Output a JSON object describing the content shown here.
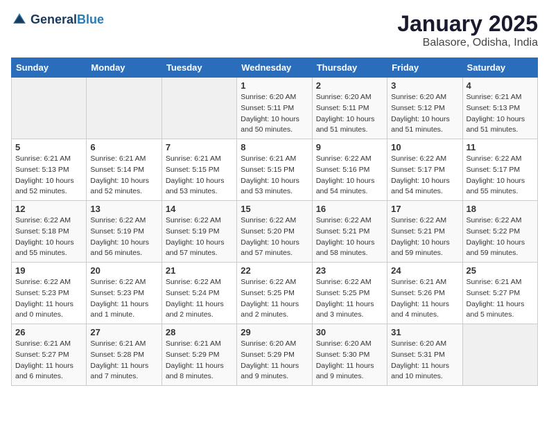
{
  "header": {
    "logo_general": "General",
    "logo_blue": "Blue",
    "month_year": "January 2025",
    "location": "Balasore, Odisha, India"
  },
  "days_of_week": [
    "Sunday",
    "Monday",
    "Tuesday",
    "Wednesday",
    "Thursday",
    "Friday",
    "Saturday"
  ],
  "weeks": [
    [
      {
        "day": "",
        "info": ""
      },
      {
        "day": "",
        "info": ""
      },
      {
        "day": "",
        "info": ""
      },
      {
        "day": "1",
        "info": "Sunrise: 6:20 AM\nSunset: 5:11 PM\nDaylight: 10 hours\nand 50 minutes."
      },
      {
        "day": "2",
        "info": "Sunrise: 6:20 AM\nSunset: 5:11 PM\nDaylight: 10 hours\nand 51 minutes."
      },
      {
        "day": "3",
        "info": "Sunrise: 6:20 AM\nSunset: 5:12 PM\nDaylight: 10 hours\nand 51 minutes."
      },
      {
        "day": "4",
        "info": "Sunrise: 6:21 AM\nSunset: 5:13 PM\nDaylight: 10 hours\nand 51 minutes."
      }
    ],
    [
      {
        "day": "5",
        "info": "Sunrise: 6:21 AM\nSunset: 5:13 PM\nDaylight: 10 hours\nand 52 minutes."
      },
      {
        "day": "6",
        "info": "Sunrise: 6:21 AM\nSunset: 5:14 PM\nDaylight: 10 hours\nand 52 minutes."
      },
      {
        "day": "7",
        "info": "Sunrise: 6:21 AM\nSunset: 5:15 PM\nDaylight: 10 hours\nand 53 minutes."
      },
      {
        "day": "8",
        "info": "Sunrise: 6:21 AM\nSunset: 5:15 PM\nDaylight: 10 hours\nand 53 minutes."
      },
      {
        "day": "9",
        "info": "Sunrise: 6:22 AM\nSunset: 5:16 PM\nDaylight: 10 hours\nand 54 minutes."
      },
      {
        "day": "10",
        "info": "Sunrise: 6:22 AM\nSunset: 5:17 PM\nDaylight: 10 hours\nand 54 minutes."
      },
      {
        "day": "11",
        "info": "Sunrise: 6:22 AM\nSunset: 5:17 PM\nDaylight: 10 hours\nand 55 minutes."
      }
    ],
    [
      {
        "day": "12",
        "info": "Sunrise: 6:22 AM\nSunset: 5:18 PM\nDaylight: 10 hours\nand 55 minutes."
      },
      {
        "day": "13",
        "info": "Sunrise: 6:22 AM\nSunset: 5:19 PM\nDaylight: 10 hours\nand 56 minutes."
      },
      {
        "day": "14",
        "info": "Sunrise: 6:22 AM\nSunset: 5:19 PM\nDaylight: 10 hours\nand 57 minutes."
      },
      {
        "day": "15",
        "info": "Sunrise: 6:22 AM\nSunset: 5:20 PM\nDaylight: 10 hours\nand 57 minutes."
      },
      {
        "day": "16",
        "info": "Sunrise: 6:22 AM\nSunset: 5:21 PM\nDaylight: 10 hours\nand 58 minutes."
      },
      {
        "day": "17",
        "info": "Sunrise: 6:22 AM\nSunset: 5:21 PM\nDaylight: 10 hours\nand 59 minutes."
      },
      {
        "day": "18",
        "info": "Sunrise: 6:22 AM\nSunset: 5:22 PM\nDaylight: 10 hours\nand 59 minutes."
      }
    ],
    [
      {
        "day": "19",
        "info": "Sunrise: 6:22 AM\nSunset: 5:23 PM\nDaylight: 11 hours\nand 0 minutes."
      },
      {
        "day": "20",
        "info": "Sunrise: 6:22 AM\nSunset: 5:23 PM\nDaylight: 11 hours\nand 1 minute."
      },
      {
        "day": "21",
        "info": "Sunrise: 6:22 AM\nSunset: 5:24 PM\nDaylight: 11 hours\nand 2 minutes."
      },
      {
        "day": "22",
        "info": "Sunrise: 6:22 AM\nSunset: 5:25 PM\nDaylight: 11 hours\nand 2 minutes."
      },
      {
        "day": "23",
        "info": "Sunrise: 6:22 AM\nSunset: 5:25 PM\nDaylight: 11 hours\nand 3 minutes."
      },
      {
        "day": "24",
        "info": "Sunrise: 6:21 AM\nSunset: 5:26 PM\nDaylight: 11 hours\nand 4 minutes."
      },
      {
        "day": "25",
        "info": "Sunrise: 6:21 AM\nSunset: 5:27 PM\nDaylight: 11 hours\nand 5 minutes."
      }
    ],
    [
      {
        "day": "26",
        "info": "Sunrise: 6:21 AM\nSunset: 5:27 PM\nDaylight: 11 hours\nand 6 minutes."
      },
      {
        "day": "27",
        "info": "Sunrise: 6:21 AM\nSunset: 5:28 PM\nDaylight: 11 hours\nand 7 minutes."
      },
      {
        "day": "28",
        "info": "Sunrise: 6:21 AM\nSunset: 5:29 PM\nDaylight: 11 hours\nand 8 minutes."
      },
      {
        "day": "29",
        "info": "Sunrise: 6:20 AM\nSunset: 5:29 PM\nDaylight: 11 hours\nand 9 minutes."
      },
      {
        "day": "30",
        "info": "Sunrise: 6:20 AM\nSunset: 5:30 PM\nDaylight: 11 hours\nand 9 minutes."
      },
      {
        "day": "31",
        "info": "Sunrise: 6:20 AM\nSunset: 5:31 PM\nDaylight: 11 hours\nand 10 minutes."
      },
      {
        "day": "",
        "info": ""
      }
    ]
  ]
}
